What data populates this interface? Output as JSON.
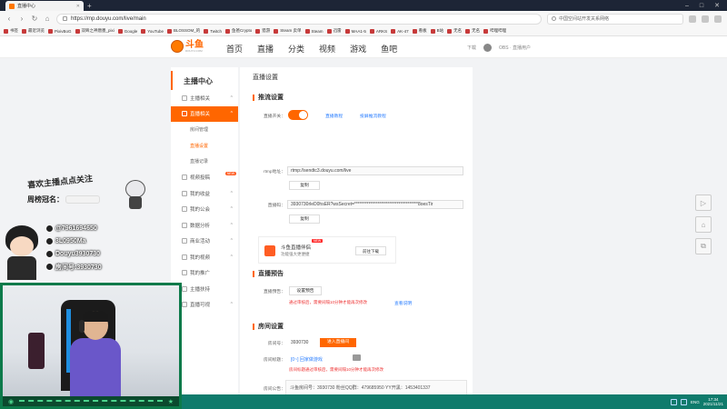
{
  "browser": {
    "tab_title": "直播中心",
    "url": "https://mp.douyu.com/live/main",
    "search_placeholder": "中国空间站开发关系网络",
    "bookmarks": [
      "书签",
      "最近浏览",
      "PixivBoG",
      "双眸之神唐墨_pixi",
      "Google",
      "YouTube",
      "BLOSSOM_的",
      "Twitch",
      "鱼爸Crypto",
      "猎游",
      "Steam 卖单",
      "Steam",
      "迅雷",
      "MAA1-5",
      "ARKS",
      "AK-47",
      "看板",
      "B站",
      "无名",
      "无名",
      "哔哩哔哩"
    ]
  },
  "header": {
    "logo_text": "斗鱼",
    "logo_sub": "DOUYU.COM",
    "nav": [
      "首页",
      "直播",
      "分类",
      "视频",
      "游戏",
      "鱼吧"
    ],
    "right_download": "下载",
    "right_user": "OBS · 直播用户"
  },
  "sidebar": {
    "title": "主播中心",
    "items": [
      {
        "label": "主播相关",
        "arrow": "^",
        "active": false
      },
      {
        "label": "直播相关",
        "arrow": "^",
        "active": true
      },
      {
        "label": "视频投稿",
        "arrow": "",
        "active": false,
        "hot": "NEW"
      },
      {
        "label": "我的收益",
        "arrow": "^",
        "active": false
      },
      {
        "label": "我的公会",
        "arrow": "^",
        "active": false
      },
      {
        "label": "数据分析",
        "arrow": "^",
        "active": false
      },
      {
        "label": "商业活动",
        "arrow": "^",
        "active": false
      },
      {
        "label": "我的视频",
        "arrow": "^",
        "active": false
      },
      {
        "label": "我的推广",
        "arrow": "",
        "active": false
      },
      {
        "label": "主播扶持",
        "arrow": "",
        "active": false
      },
      {
        "label": "直播可视",
        "arrow": "^",
        "active": false
      }
    ],
    "subitems": [
      "房间管理",
      "直播设置",
      "直播记录"
    ]
  },
  "main": {
    "title": "直播设置",
    "section1": "推流设置",
    "toggle_label": "直播开关：",
    "toggle_link1": "直播教程",
    "toggle_link2": "投屏推流教程",
    "rtmp_label": "rtmp地址：",
    "rtmp_value": "rtmp://sendtc3.douyu.com/live",
    "copy": "复制",
    "code_label": "直播码：",
    "code_value": "3930730rleD0hsER?wsSecret=************************************8oesTir",
    "promo_title": "斗鱼直播伴侣",
    "promo_new": "NEW",
    "promo_sub": "功能强大更便捷",
    "promo_btn": "前往下载",
    "section2": "直播预告",
    "notice_label": "直播预告：",
    "notice_btn": "设置预告",
    "notice_red": "通过审核后，需要间隔10分钟才能再次修改",
    "notice_link": "查看说明",
    "section3": "房间设置",
    "room_label": "房间号：",
    "room_value": "3930730",
    "room_btn": "进入直播间",
    "roomtitle_label": "房间标题：",
    "roomtitle_value": "[0~] 回家做游戏",
    "roomtitle_red": "房间标题通过审核后，需要间隔10分钟才能再次修改",
    "announce_label": "房间公告：",
    "announce_value": "斗鱼房间号：3930730 粉丝QQ群：479685950 YY开黑：1453401337"
  },
  "overlay": {
    "greeting": "喜欢主播点点关注",
    "id_label": "周榜冠名：",
    "socials": [
      {
        "icon": "qq-icon",
        "value": "@7961694650"
      },
      {
        "icon": "weibo-icon",
        "value": "3L0950Ma"
      },
      {
        "icon": "douyin-icon",
        "value": "Douyu3930730"
      },
      {
        "icon": "fans-icon",
        "value": "房间号:3930730"
      }
    ]
  },
  "taskbar": {
    "lang": "ENG",
    "time": "17:34",
    "date": "2021/11/21"
  }
}
